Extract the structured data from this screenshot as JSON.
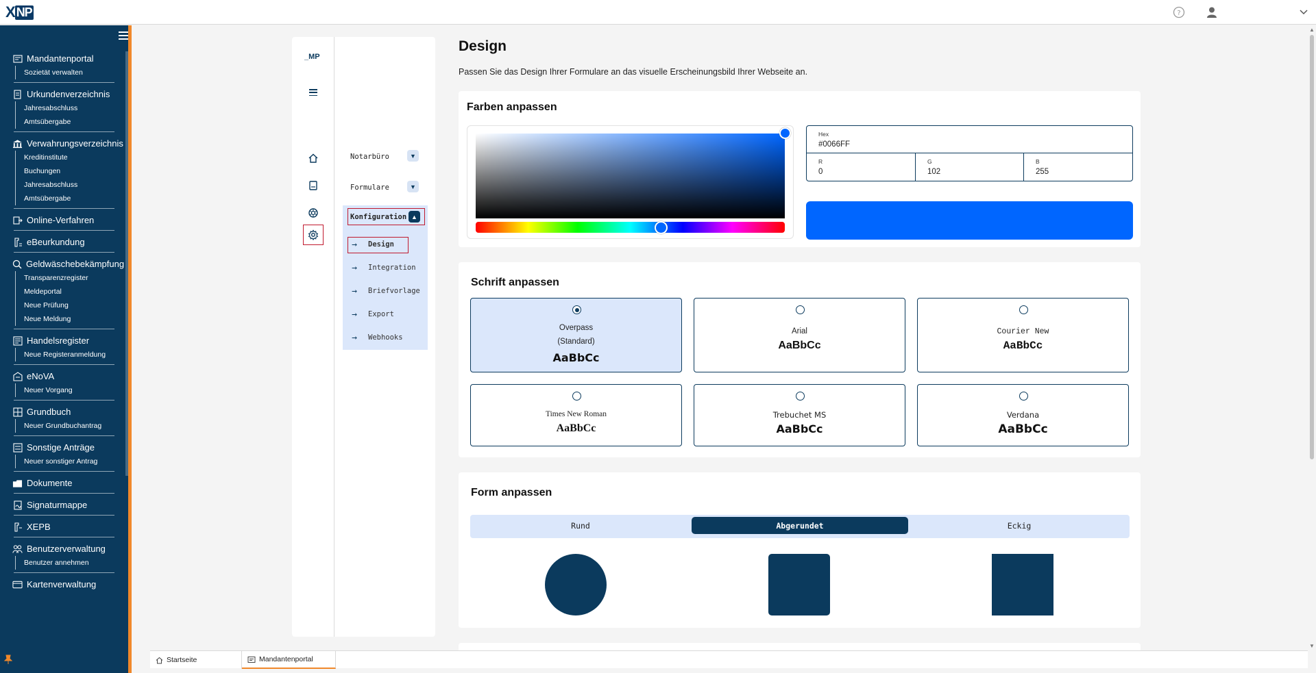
{
  "app": {
    "logo_text_x": "X",
    "logo_text_np": "NP"
  },
  "sidebar": {
    "groups": [
      {
        "label": "Mandantenportal",
        "icon": "portal-icon",
        "items": [
          "Sozietät verwalten"
        ]
      },
      {
        "label": "Urkundenverzeichnis",
        "icon": "register-icon",
        "items": [
          "Jahresabschluss",
          "Amtsübergabe"
        ]
      },
      {
        "label": "Verwahrungsverzeichnis",
        "icon": "bank-icon",
        "items": [
          "Kreditinstitute",
          "Buchungen",
          "Jahresabschluss",
          "Amtsübergabe"
        ]
      },
      {
        "label": "Online-Verfahren",
        "icon": "online-icon",
        "items": []
      },
      {
        "label": "eBeurkundung",
        "icon": "stamp-icon",
        "items": []
      },
      {
        "label": "Geldwäschebekämpfung",
        "icon": "search-money-icon",
        "items": [
          "Transparenzregister",
          "Meldeportal",
          "Neue Prüfung",
          "Neue Meldung"
        ]
      },
      {
        "label": "Handelsregister",
        "icon": "trade-register-icon",
        "items": [
          "Neue Registeranmeldung"
        ]
      },
      {
        "label": "eNoVA",
        "icon": "enova-icon",
        "items": [
          "Neuer Vorgang"
        ]
      },
      {
        "label": "Grundbuch",
        "icon": "land-register-icon",
        "items": [
          "Neuer Grundbuchantrag"
        ]
      },
      {
        "label": "Sonstige Anträge",
        "icon": "other-requests-icon",
        "items": [
          "Neuer sonstiger Antrag"
        ]
      },
      {
        "label": "Dokumente",
        "icon": "documents-icon",
        "items": []
      },
      {
        "label": "Signaturmappe",
        "icon": "signature-folder-icon",
        "items": []
      },
      {
        "label": "XEPB",
        "icon": "xepb-icon",
        "items": []
      },
      {
        "label": "Benutzerverwaltung",
        "icon": "users-icon",
        "items": [
          "Benutzer annehmen"
        ]
      },
      {
        "label": "Kartenverwaltung",
        "icon": "card-icon",
        "items": []
      }
    ]
  },
  "inner_nav": {
    "mark": "_MP",
    "menus": [
      {
        "label": "Notarbüro"
      },
      {
        "label": "Formulare"
      }
    ],
    "active_menu": "Konfiguration",
    "submenu": [
      "Design",
      "Integration",
      "Briefvorlage",
      "Export",
      "Webhooks"
    ]
  },
  "page": {
    "title": "Design",
    "description": "Passen Sie das Design Ihrer Formulare an das visuelle Erscheinungsbild Ihrer Webseite an."
  },
  "colors_section": {
    "title": "Farben anpassen",
    "hex_label": "Hex",
    "hex_value": "#0066FF",
    "r_label": "R",
    "r_value": "0",
    "g_label": "G",
    "g_value": "102",
    "b_label": "B",
    "b_value": "255",
    "selected_color": "#0066FF",
    "hue_position": 0.6
  },
  "font_section": {
    "title": "Schrift anpassen",
    "options": [
      {
        "name": "Overpass",
        "note": "(Standard)",
        "sample": "AaBbCc",
        "selected": true
      },
      {
        "name": "Arial",
        "sample": "AaBbCc",
        "selected": false
      },
      {
        "name": "Courier New",
        "sample": "AaBbCc",
        "selected": false
      },
      {
        "name": "Times New Roman",
        "sample": "AaBbCc",
        "selected": false
      },
      {
        "name": "Trebuchet MS",
        "sample": "AaBbCc",
        "selected": false
      },
      {
        "name": "Verdana",
        "sample": "AaBbCc",
        "selected": false
      }
    ]
  },
  "shape_section": {
    "title": "Form anpassen",
    "tabs": [
      "Rund",
      "Abgerundet",
      "Eckig"
    ],
    "active_tab": "Abgerundet"
  },
  "bottom_tabs": [
    {
      "label": "Startseite",
      "active": false
    },
    {
      "label": "Mandantenportal",
      "active": true
    }
  ],
  "theme": {
    "primary": "#0B3A5D",
    "accent": "#F0882A",
    "highlight": "#C0192D",
    "selected_bg": "#DBE7FB"
  }
}
